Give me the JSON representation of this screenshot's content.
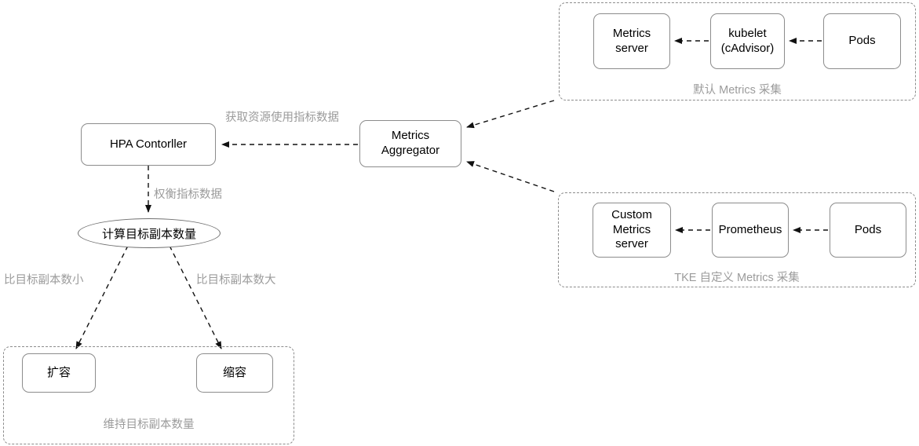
{
  "diagram": {
    "title_hidden": "Kubernetes HPA metrics flow diagram",
    "nodes": {
      "hpa_controller": "HPA Contorller",
      "metrics_aggregator": "Metrics\nAggregator",
      "compute_replicas": "计算目标副本数量",
      "scale_up": "扩容",
      "scale_down": "缩容",
      "metrics_server": "Metrics\nserver",
      "kubelet": "kubelet\n(cAdvisor)",
      "pods_top": "Pods",
      "custom_metrics_server": "Custom\nMetrics\nserver",
      "prometheus": "Prometheus",
      "pods_bottom": "Pods"
    },
    "groups": {
      "default_metrics_caption": "默认 Metrics 采集",
      "tke_custom_metrics_caption": "TKE 自定义 Metrics 采集",
      "maintain_replicas_caption": "维持目标副本数量"
    },
    "edge_labels": {
      "fetch_resource_metrics": "获取资源使用指标数据",
      "weigh_metrics": "权衡指标数据",
      "less_than_target": "比目标副本数小",
      "greater_than_target": "比目标副本数大"
    },
    "colors": {
      "node_border": "#8c8c8c",
      "group_border": "#8c8c8c",
      "edge_stroke": "#111111",
      "label_text": "#9b9b9b",
      "node_text": "#000000",
      "background": "#ffffff"
    }
  }
}
